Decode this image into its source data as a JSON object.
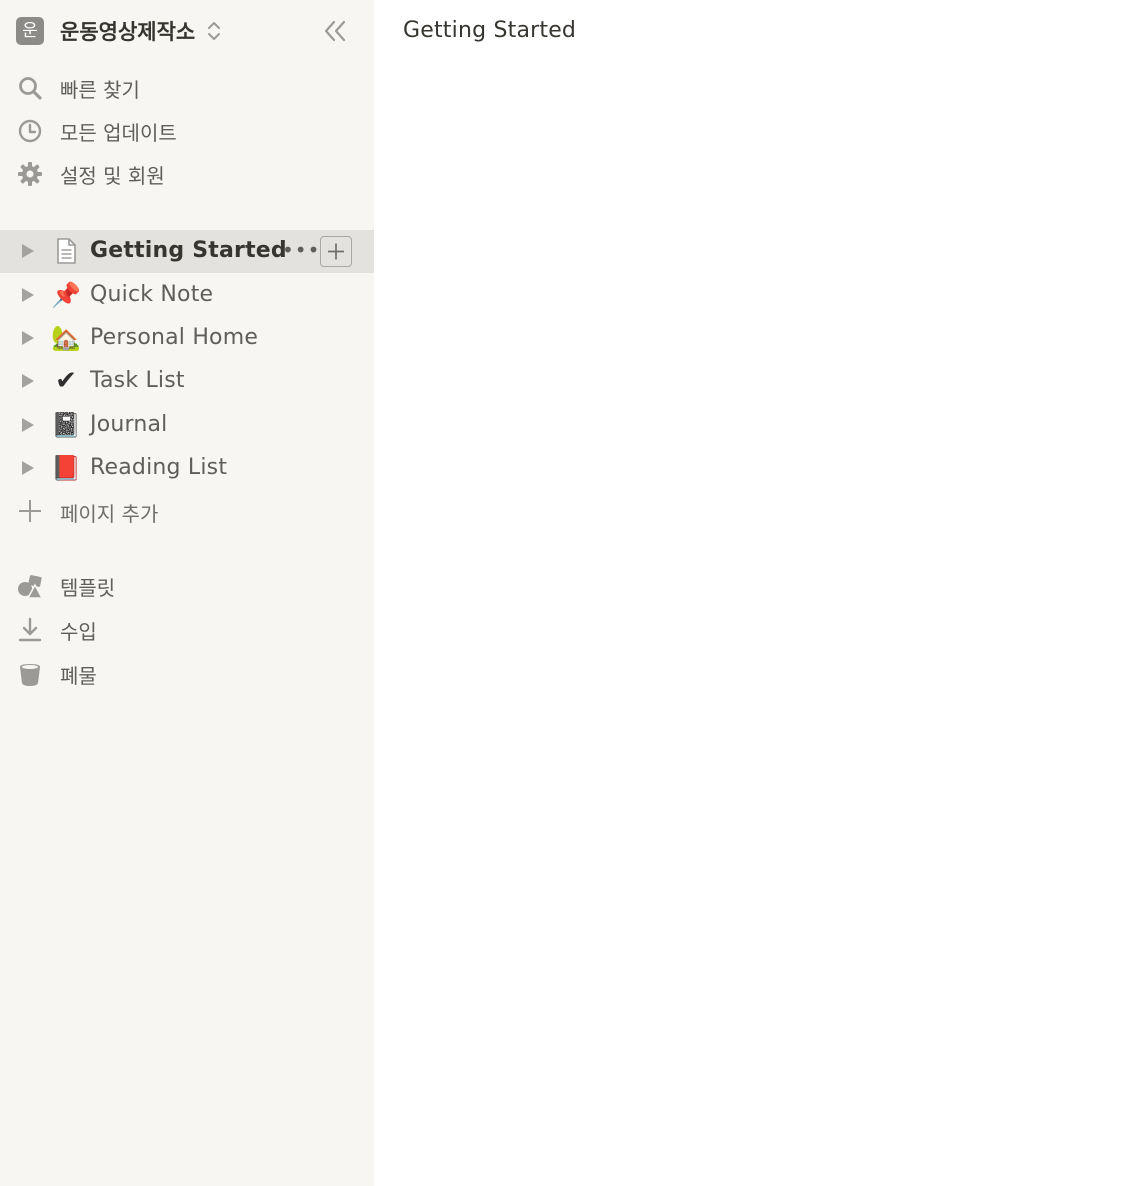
{
  "workspace": {
    "avatar_letter": "운",
    "name": "운동영상제작소",
    "switcher_icon": "chevron-up-down-icon",
    "collapse_icon": "double-chevron-left-icon"
  },
  "menu": [
    {
      "label": "빠른 찾기",
      "icon": "search-icon"
    },
    {
      "label": "모든 업데이트",
      "icon": "clock-icon"
    },
    {
      "label": "설정 및 회원",
      "icon": "gear-icon"
    }
  ],
  "pages": [
    {
      "label": "Getting Started",
      "icon": "document-icon",
      "glyph": "",
      "selected": true
    },
    {
      "label": "Quick Note",
      "icon": "pushpin-icon",
      "glyph": "📌"
    },
    {
      "label": "Personal Home",
      "icon": "house-with-tree-icon",
      "glyph": "🏡"
    },
    {
      "label": "Task List",
      "icon": "check-mark-icon",
      "glyph": "✔"
    },
    {
      "label": "Journal",
      "icon": "notebook-icon",
      "glyph": "📓"
    },
    {
      "label": "Reading List",
      "icon": "red-book-icon",
      "glyph": "📕"
    }
  ],
  "page_actions": {
    "more_icon": "more-horizontal-icon",
    "more_glyph": "•••",
    "add_icon": "plus-icon"
  },
  "add_page": {
    "label": "페이지 추가",
    "icon": "plus-icon"
  },
  "bottom_menu": [
    {
      "label": "템플릿",
      "icon": "shapes-icon"
    },
    {
      "label": "수입",
      "icon": "download-icon"
    },
    {
      "label": "폐물",
      "icon": "trash-icon"
    }
  ],
  "main": {
    "title": "Getting Started"
  },
  "colors": {
    "sidebar_bg": "#f7f6f3",
    "selected_bg": "#e3e2df",
    "icon_gray": "#9b9a97",
    "text_primary": "#37352f",
    "text_secondary": "#5f5e5b"
  }
}
